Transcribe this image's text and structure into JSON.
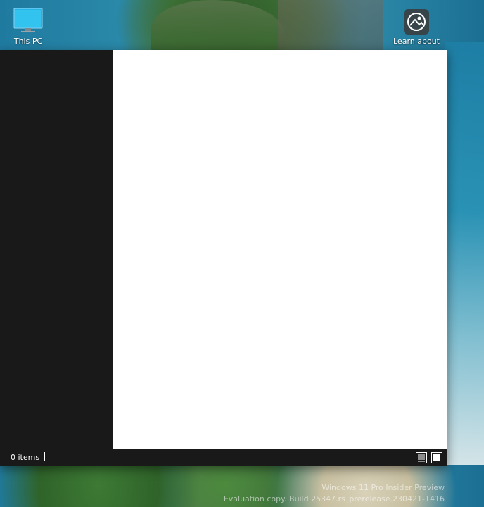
{
  "desktop": {
    "icons": [
      {
        "label": "This PC",
        "icon": "this-pc-icon"
      },
      {
        "label": "Learn about",
        "icon": "learn-about-icon"
      }
    ],
    "watermark": {
      "line1": "Windows 11 Pro Insider Preview",
      "line2": "Evaluation copy. Build 25347.rs_prerelease.230421-1416"
    }
  },
  "explorer": {
    "status": {
      "item_count": "0 items"
    },
    "view_buttons": [
      "details-view-icon",
      "large-icons-view-icon"
    ]
  },
  "colors": {
    "nav_pane": "#191919",
    "content": "#ffffff",
    "statusbar": "#191919"
  }
}
